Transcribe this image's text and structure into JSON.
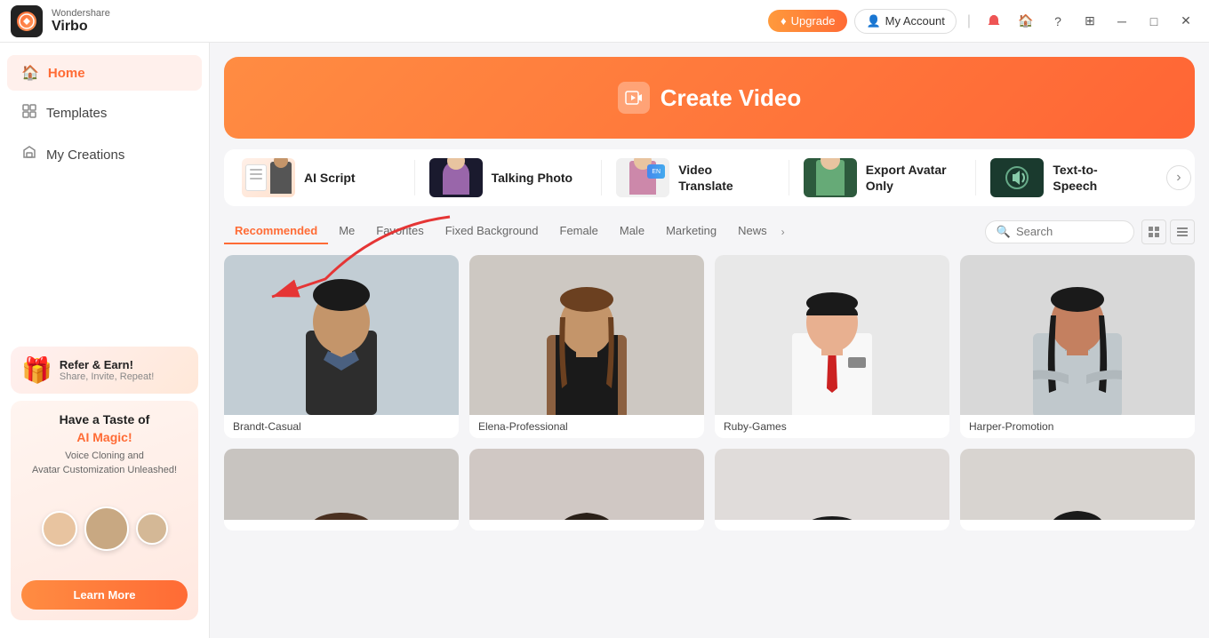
{
  "app": {
    "brand": "Wondershare",
    "name": "Virbo",
    "logo_char": "V"
  },
  "titlebar": {
    "upgrade_label": "Upgrade",
    "my_account_label": "My Account"
  },
  "sidebar": {
    "items": [
      {
        "id": "home",
        "label": "Home",
        "active": true
      },
      {
        "id": "templates",
        "label": "Templates",
        "active": false
      },
      {
        "id": "my-creations",
        "label": "My Creations",
        "active": false
      }
    ],
    "promo_refer": {
      "title": "Refer & Earn!",
      "subtitle": "Share, Invite, Repeat!"
    },
    "promo_ai": {
      "title_line1": "Have a Taste of",
      "title_line2": "AI Magic!",
      "description": "Voice Cloning and\nAvatar Customization Unleashed!",
      "cta": "Learn More"
    }
  },
  "hero": {
    "label": "Create Video"
  },
  "features": [
    {
      "id": "ai-script",
      "label": "AI Script"
    },
    {
      "id": "talking-photo",
      "label": "Talking Photo"
    },
    {
      "id": "video-translate",
      "label": "Video Translate"
    },
    {
      "id": "export-avatar-only",
      "label": "Export Avatar Only"
    },
    {
      "id": "text-to-speech",
      "label": "Text-to-Speech"
    }
  ],
  "tabs": {
    "items": [
      {
        "id": "recommended",
        "label": "Recommended",
        "active": true
      },
      {
        "id": "me",
        "label": "Me",
        "active": false
      },
      {
        "id": "favorites",
        "label": "Favorites",
        "active": false
      },
      {
        "id": "fixed-background",
        "label": "Fixed Background",
        "active": false
      },
      {
        "id": "female",
        "label": "Female",
        "active": false
      },
      {
        "id": "male",
        "label": "Male",
        "active": false
      },
      {
        "id": "marketing",
        "label": "Marketing",
        "active": false
      },
      {
        "id": "news",
        "label": "News",
        "active": false
      }
    ],
    "search_placeholder": "Search"
  },
  "avatars": [
    {
      "id": "brandt",
      "name": "Brandt-Casual",
      "bg": "#c2cdd4",
      "skin": "#c4956a",
      "outfit": "#2d2d2d"
    },
    {
      "id": "elena",
      "name": "Elena-Professional",
      "bg": "#cdc8c2",
      "skin": "#c4956a",
      "outfit": "#8b6040"
    },
    {
      "id": "ruby",
      "name": "Ruby-Games",
      "bg": "#e8e8e8",
      "skin": "#e8b090",
      "outfit": "#e8e8e8"
    },
    {
      "id": "harper",
      "name": "Harper-Promotion",
      "bg": "#d8d8d8",
      "skin": "#c48060",
      "outfit": "#c0c8c8"
    },
    {
      "id": "av5",
      "name": "",
      "bg": "#c8c4c0"
    },
    {
      "id": "av6",
      "name": "",
      "bg": "#d0c8c4"
    },
    {
      "id": "av7",
      "name": "",
      "bg": "#e0dcda"
    },
    {
      "id": "av8",
      "name": "",
      "bg": "#d8d4d0"
    }
  ]
}
